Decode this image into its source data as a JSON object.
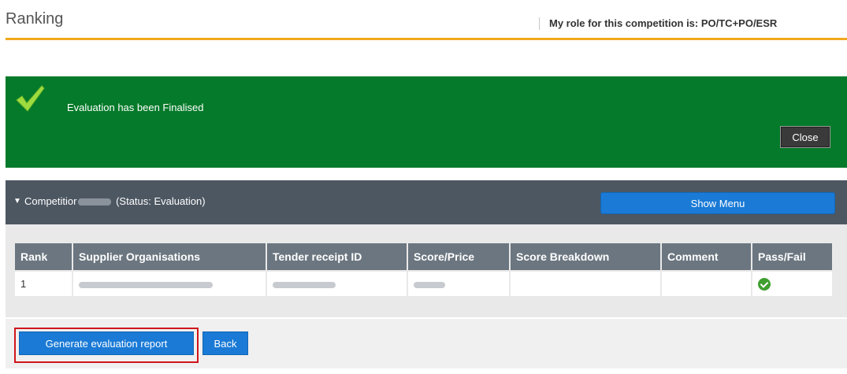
{
  "header": {
    "title": "Ranking",
    "role_text": "My role for this competition is: PO/TC+PO/ESR"
  },
  "banner": {
    "message": "Evaluation has been Finalised",
    "close_label": "Close"
  },
  "competition": {
    "prefix": "Competitior",
    "status": "(Status: Evaluation)",
    "show_menu_label": "Show Menu"
  },
  "table": {
    "headers": [
      "Rank",
      "Supplier Organisations",
      "Tender receipt ID",
      "Score/Price",
      "Score Breakdown",
      "Comment",
      "Pass/Fail"
    ],
    "rows": [
      {
        "rank": "1",
        "pass_icon": "check-circle-icon"
      }
    ]
  },
  "actions": {
    "generate_label": "Generate evaluation report",
    "back_label": "Back"
  },
  "colors": {
    "accent_rule": "#f0a81c",
    "banner_green": "#057a2a",
    "button_blue": "#1a7ad6",
    "highlight_red": "#d0161b"
  }
}
